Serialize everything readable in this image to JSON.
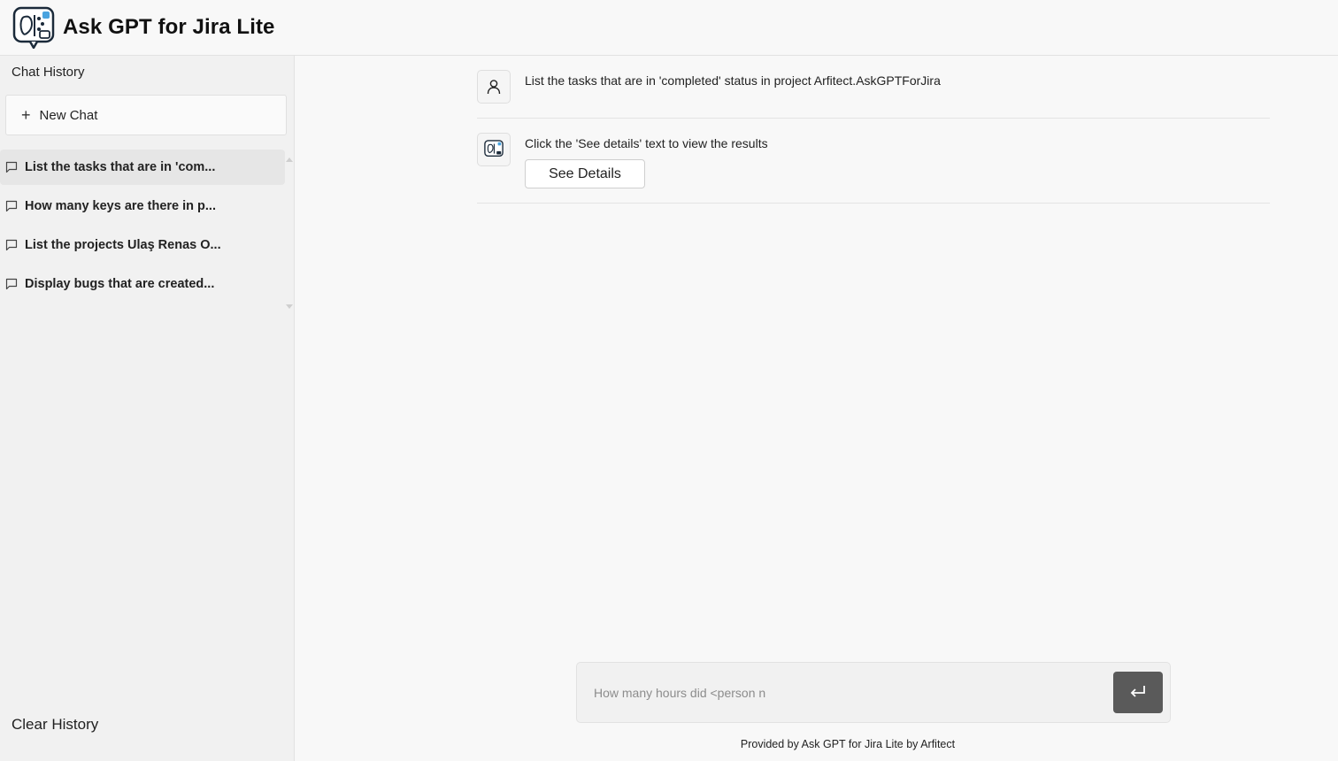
{
  "app": {
    "title": "Ask GPT for Jira Lite"
  },
  "sidebar": {
    "section_title": "Chat History",
    "new_chat_label": "New Chat",
    "history": [
      {
        "label": "List the tasks that are in 'com...",
        "active": true
      },
      {
        "label": "How many keys are there in p...",
        "active": false
      },
      {
        "label": "List the projects Ulaş Renas O...",
        "active": false
      },
      {
        "label": "Display bugs that are created...",
        "active": false
      }
    ],
    "clear_label": "Clear History"
  },
  "conversation": {
    "user_message": "List the tasks that are in 'completed' status in project Arfitect.AskGPTForJira",
    "bot_message": "Click the 'See details' text to view the results",
    "see_details_label": "See Details"
  },
  "composer": {
    "placeholder": "How many hours did <person n",
    "value": ""
  },
  "footer": {
    "text": "Provided by Ask GPT for Jira Lite by Arfitect"
  },
  "icons": {
    "logo": "ai-brain-chat-logo-icon",
    "new_chat": "plus-icon",
    "history_item": "chat-bubble-icon",
    "user_avatar": "user-icon",
    "bot_avatar": "ai-brain-icon",
    "send": "enter-return-icon"
  },
  "colors": {
    "background": "#f8f8f8",
    "sidebar": "#f1f1f1",
    "active_item": "#e6e6e6",
    "send_button": "#5a5a5a",
    "logo_accent": "#4aa3df"
  }
}
